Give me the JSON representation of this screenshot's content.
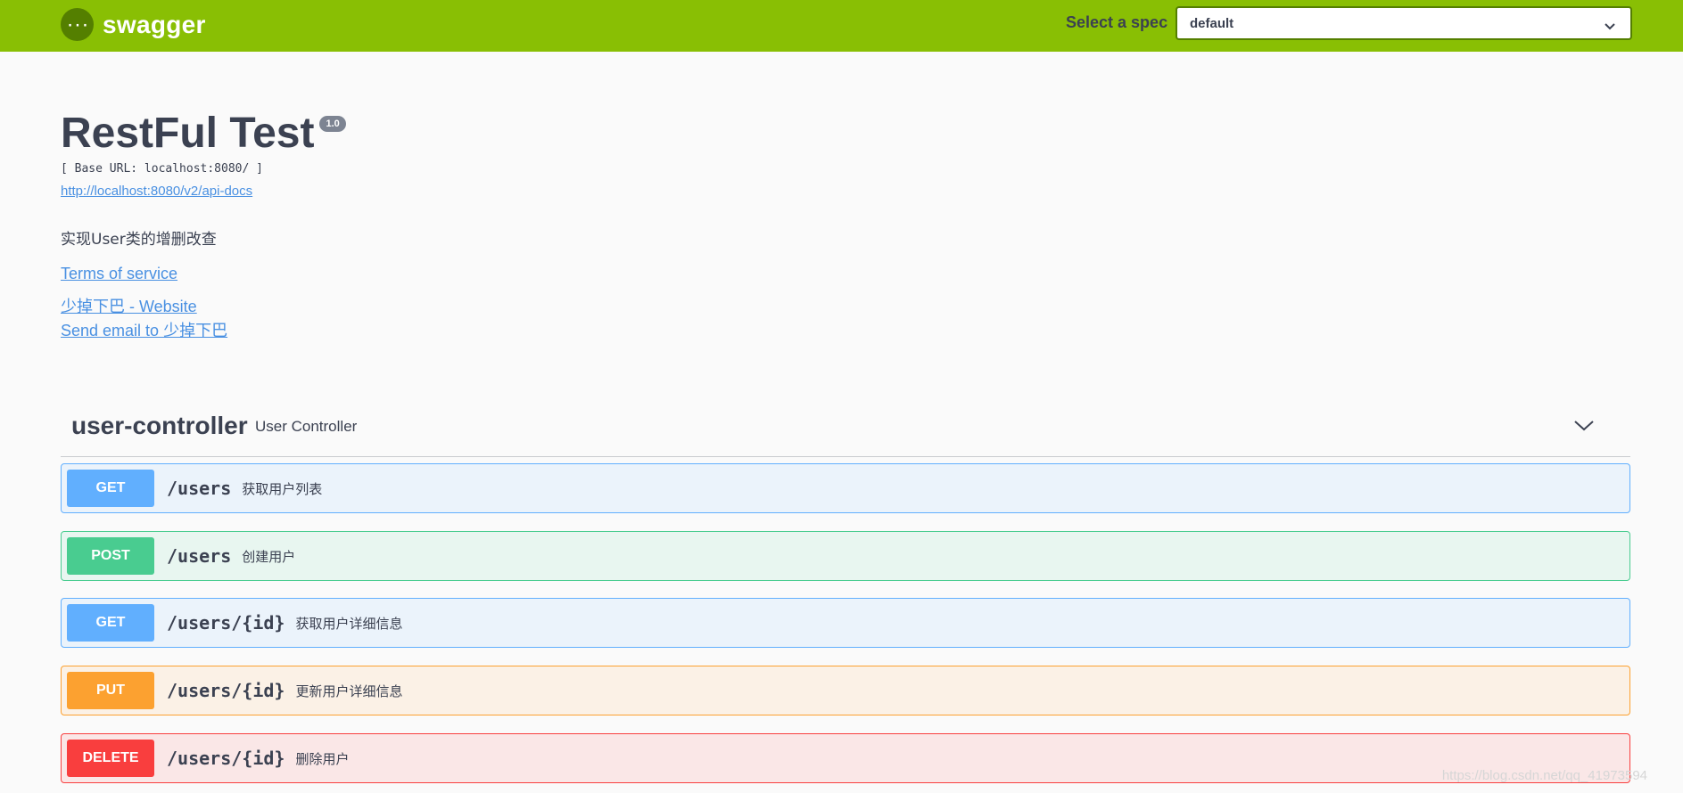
{
  "topbar": {
    "brand": "swagger",
    "spec_label": "Select a spec",
    "spec_selected": "default"
  },
  "info": {
    "title": "RestFul Test",
    "version": "1.0",
    "base_url": "[ Base URL: localhost:8080/ ]",
    "api_docs_link": "http://localhost:8080/v2/api-docs",
    "description": "实现User类的增删改查",
    "terms": "Terms of service",
    "website": "少掉下巴 - Website",
    "email": "Send email to 少掉下巴"
  },
  "tag": {
    "name": "user-controller",
    "description": "User Controller"
  },
  "operations": [
    {
      "method": "GET",
      "path": "/users",
      "summary": "获取用户列表"
    },
    {
      "method": "POST",
      "path": "/users",
      "summary": "创建用户"
    },
    {
      "method": "GET",
      "path": "/users/{id}",
      "summary": "获取用户详细信息"
    },
    {
      "method": "PUT",
      "path": "/users/{id}",
      "summary": "更新用户详细信息"
    },
    {
      "method": "DELETE",
      "path": "/users/{id}",
      "summary": "删除用户"
    }
  ],
  "watermark": "https://blog.csdn.net/qq_41973594",
  "colors": {
    "topbar": "#89bf04",
    "get": "#61affe",
    "post": "#49cc90",
    "put": "#fca130",
    "delete": "#f93e3e"
  }
}
